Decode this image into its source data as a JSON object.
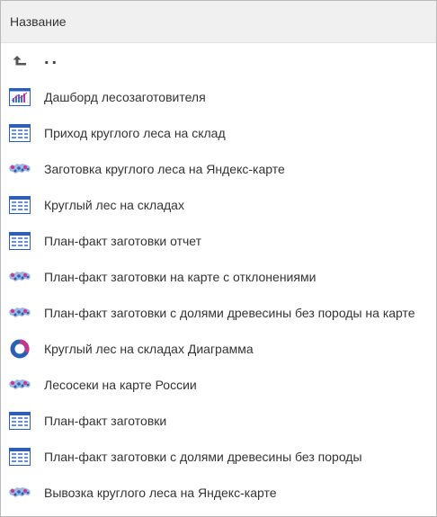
{
  "header": {
    "column_title": "Название"
  },
  "parent_row": {
    "label": "..",
    "icon": "level-up-icon"
  },
  "items": [
    {
      "label": "Дашборд лесозаготовителя",
      "icon": "dashboard-icon"
    },
    {
      "label": "Приход круглого леса на склад",
      "icon": "table-report-icon"
    },
    {
      "label": "Заготовка круглого леса на Яндекс-карте",
      "icon": "map-icon"
    },
    {
      "label": "Круглый лес на складах",
      "icon": "table-report-icon"
    },
    {
      "label": "План-факт заготовки отчет",
      "icon": "table-report-icon"
    },
    {
      "label": "План-факт заготовки на карте с отклонениями",
      "icon": "map-icon"
    },
    {
      "label": "План-факт заготовки с долями древесины без породы на карте",
      "icon": "map-icon"
    },
    {
      "label": "Круглый лес на складах Диаграмма",
      "icon": "donut-chart-icon"
    },
    {
      "label": "Лесосеки на карте России",
      "icon": "map-icon"
    },
    {
      "label": "План-факт заготовки",
      "icon": "table-report-icon"
    },
    {
      "label": "План-факт заготовки с долями древесины без породы",
      "icon": "table-report-icon"
    },
    {
      "label": "Вывозка круглого леса на Яндекс-карте",
      "icon": "map-icon"
    }
  ]
}
